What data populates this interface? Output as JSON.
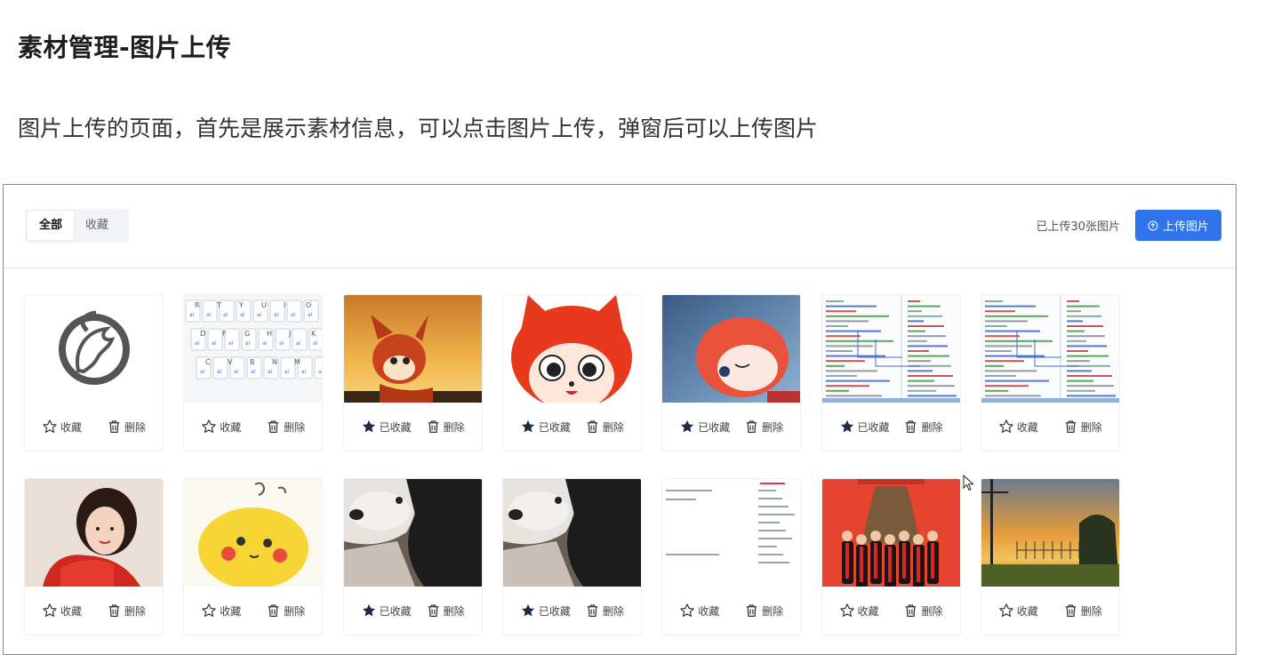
{
  "doc": {
    "title": "素材管理-图片上传",
    "description": "图片上传的页面，首先是展示素材信息，可以点击图片上传，弹窗后可以上传图片"
  },
  "toolbar": {
    "tabs": [
      {
        "label": "全部",
        "active": true
      },
      {
        "label": "收藏",
        "active": false
      }
    ],
    "count_text": "已上传30张图片",
    "upload_label": "上传图片",
    "upload_icon": "upload-circle-icon",
    "accent_color": "#2f74eb"
  },
  "cards": [
    {
      "image": "dragon-logo",
      "favorited": false,
      "fav_label": "收藏",
      "delete_label": "删除"
    },
    {
      "image": "keyboard-layout",
      "favorited": false,
      "fav_label": "收藏",
      "delete_label": "删除"
    },
    {
      "image": "fox-sunset",
      "favorited": true,
      "fav_label": "已收藏",
      "delete_label": "删除"
    },
    {
      "image": "fox-face",
      "favorited": true,
      "fav_label": "已收藏",
      "delete_label": "删除"
    },
    {
      "image": "fox-sleeping",
      "favorited": true,
      "fav_label": "已收藏",
      "delete_label": "删除"
    },
    {
      "image": "code-screenshot",
      "favorited": true,
      "fav_label": "已收藏",
      "delete_label": "删除"
    },
    {
      "image": "code-screenshot",
      "favorited": false,
      "fav_label": "收藏",
      "delete_label": "删除"
    },
    {
      "image": "woman-portrait",
      "favorited": false,
      "fav_label": "收藏",
      "delete_label": "删除"
    },
    {
      "image": "yellow-cartoon",
      "favorited": false,
      "fav_label": "收藏",
      "delete_label": "删除"
    },
    {
      "image": "husky-dog",
      "favorited": true,
      "fav_label": "已收藏",
      "delete_label": "删除"
    },
    {
      "image": "husky-dog",
      "favorited": true,
      "fav_label": "已收藏",
      "delete_label": "删除"
    },
    {
      "image": "text-document",
      "favorited": false,
      "fav_label": "收藏",
      "delete_label": "删除"
    },
    {
      "image": "bell-ceremony",
      "favorited": false,
      "fav_label": "收藏",
      "delete_label": "删除"
    },
    {
      "image": "sunset-field",
      "favorited": false,
      "fav_label": "收藏",
      "delete_label": "删除"
    }
  ]
}
